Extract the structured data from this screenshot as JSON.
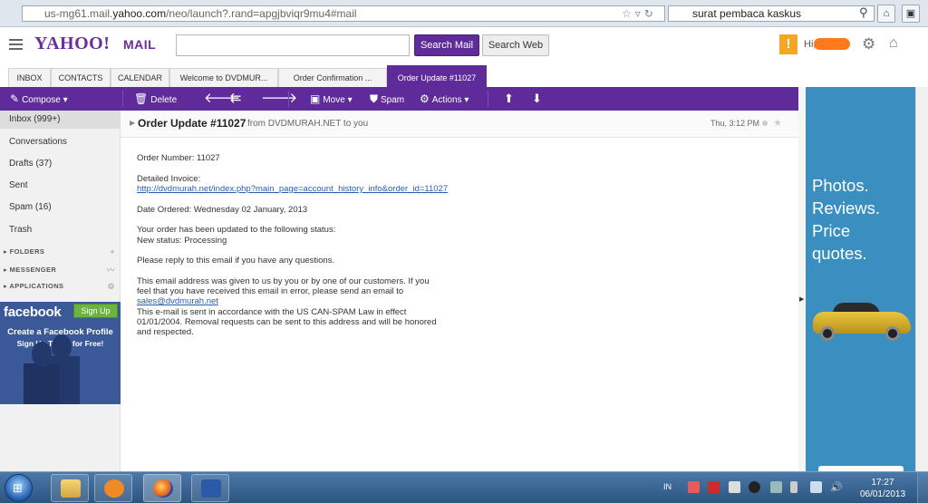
{
  "browser": {
    "url_host_prefix": "us-mg61.mail.",
    "url_host": "yahoo.com",
    "url_path": "/neo/launch?.rand=apgjbviqr9mu4#mail",
    "search_query": "surat pembaca kaskus"
  },
  "header": {
    "logo_text": "YAHOO!",
    "mail_text": "MAIL",
    "search_mail_label": "Search Mail",
    "search_web_label": "Search Web",
    "greeting": "Hi,"
  },
  "tabs": [
    {
      "label": "INBOX"
    },
    {
      "label": "CONTACTS"
    },
    {
      "label": "CALENDAR"
    },
    {
      "label": "Welcome to DVDMUR..."
    },
    {
      "label": "Order Confirmation ..."
    },
    {
      "label": "Order Update #11027"
    }
  ],
  "toolbar": {
    "compose": "Compose",
    "delete": "Delete",
    "move": "Move",
    "spam": "Spam",
    "actions": "Actions"
  },
  "sidebar": {
    "items": [
      {
        "label": "Inbox (999+)"
      },
      {
        "label": "Conversations"
      },
      {
        "label": "Drafts (37)"
      },
      {
        "label": "Sent"
      },
      {
        "label": "Spam (16)"
      },
      {
        "label": "Trash"
      }
    ],
    "sections": [
      {
        "label": "FOLDERS"
      },
      {
        "label": "MESSENGER"
      },
      {
        "label": "APPLICATIONS"
      }
    ]
  },
  "fb_ad": {
    "logo": "facebook",
    "signup": "Sign Up",
    "line1": "Create a Facebook Profile",
    "line2": "Sign Up Today for Free!"
  },
  "message": {
    "subject": "Order Update #11027",
    "from": "from DVDMURAH.NET to you",
    "date": "Thu, 3:12 PM",
    "order_number": "Order Number: 11027",
    "invoice_label": "Detailed Invoice:",
    "invoice_link": "http://dvdmurah.net/index.php?main_page=account_history_info&order_id=11027",
    "date_ordered": "Date Ordered: Wednesday 02 January, 2013",
    "status_line1": "Your order has been updated to the following status:",
    "status_line2": "New status: Processing",
    "reply_line": "Please reply to this email if you have any questions.",
    "given_line1": "This email address was given to us by you or by one of our customers. If you",
    "given_line2": "feel that you have received this email in error, please send an email to",
    "sales_link": "sales@dvdmurah.net",
    "spam_line1": "This e-mail is sent in accordance with the US CAN-SPAM Law in effect",
    "spam_line2": "01/01/2004. Removal requests can be sent to this address and will be honored",
    "spam_line3": "and respected."
  },
  "right_ad": {
    "line1": "Photos.",
    "line2": "Reviews.",
    "line3": "Price",
    "line4": "quotes."
  },
  "taskbar": {
    "lang": "IN",
    "time": "17:27",
    "date": "06/01/2013"
  }
}
